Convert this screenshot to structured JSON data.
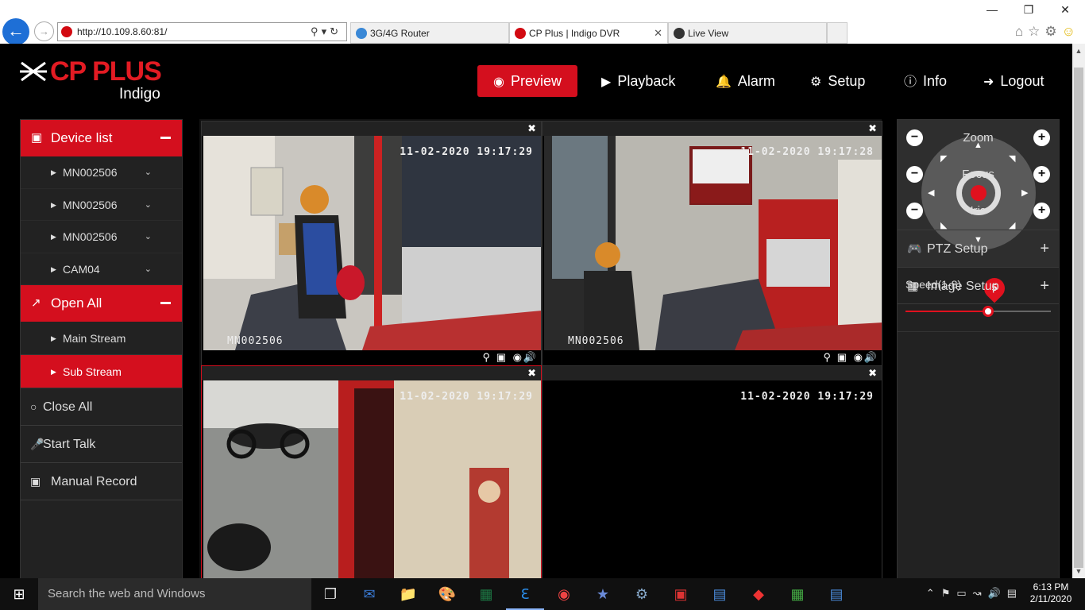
{
  "browser": {
    "address": "http://10.109.8.60:81/",
    "tabs": [
      {
        "label": "3G/4G Router",
        "active": false
      },
      {
        "label": "CP Plus | Indigo DVR",
        "active": true
      },
      {
        "label": "Live View",
        "active": false
      }
    ]
  },
  "app": {
    "brand": "CP PLUS",
    "subbrand": "Indigo",
    "nav": [
      {
        "label": "Preview",
        "icon": "eye-icon",
        "active": true
      },
      {
        "label": "Playback",
        "icon": "play-circle-icon"
      },
      {
        "label": "Alarm",
        "icon": "bell-icon"
      },
      {
        "label": "Setup",
        "icon": "gear-icon"
      },
      {
        "label": "Info",
        "icon": "info-icon"
      },
      {
        "label": "Logout",
        "icon": "logout-icon"
      }
    ]
  },
  "left_panel": {
    "device_list_label": "Device list",
    "devices": [
      "MN002506",
      "MN002506",
      "MN002506",
      "CAM04"
    ],
    "open_all_label": "Open All",
    "streams": [
      {
        "label": "Main Stream",
        "active": false
      },
      {
        "label": "Sub Stream",
        "active": true
      }
    ],
    "close_all_label": "Close All",
    "start_talk_label": "Start Talk",
    "manual_record_label": "Manual Record"
  },
  "video": {
    "cells": [
      {
        "timestamp": "11-02-2020 19:17:29",
        "label": "MN002506"
      },
      {
        "timestamp": "11-02-2020 19:17:28",
        "label": "MN002506"
      },
      {
        "timestamp": "11-02-2020 19:17:29",
        "label": ""
      },
      {
        "timestamp": "11-02-2020 19:17:29",
        "label": ""
      }
    ]
  },
  "right_panel": {
    "speed_label": "Speed(1-8)",
    "speed_value": "5",
    "speed_fraction": 0.57,
    "zoom_label": "Zoom",
    "focus_label": "Focus",
    "iris_label": "Iris",
    "ptz_setup_label": "PTZ Setup",
    "image_setup_label": "Image Setup"
  },
  "taskbar": {
    "search_placeholder": "Search the web and Windows",
    "time": "6:13 PM",
    "date": "2/11/2020"
  },
  "colors": {
    "accent_red": "#d40f1e",
    "panel_bg": "#222222",
    "background": "#000000"
  }
}
